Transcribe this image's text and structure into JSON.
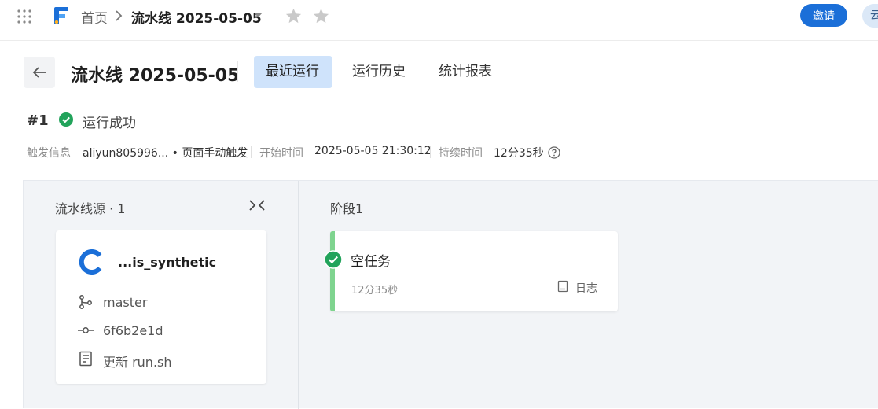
{
  "breadcrumb": {
    "home": "首页",
    "current": "流水线 2025-05-05"
  },
  "topbar": {
    "invite_label": "邀请",
    "avatar_text": "云",
    "brand_color": "#1b6fd8"
  },
  "header": {
    "title": "流水线 2025-05-05",
    "tabs": [
      {
        "label": "最近运行",
        "active": true
      },
      {
        "label": "运行历史",
        "active": false
      },
      {
        "label": "统计报表",
        "active": false
      }
    ]
  },
  "run": {
    "number": "#1",
    "status": "运行成功",
    "status_color": "#22a35b",
    "meta": {
      "trigger_label": "触发信息",
      "trigger_value": "aliyun805996... • 页面手动触发",
      "start_label": "开始时间",
      "start_value": "2025-05-05 21:30:12",
      "duration_label": "持续时间",
      "duration_value": "12分35秒"
    }
  },
  "source": {
    "title": "流水线源 · 1",
    "repo_name": "...is_synthetic",
    "branch": "master",
    "commit": "6f6b2e1d",
    "message": "更新 run.sh"
  },
  "stage": {
    "title": "阶段1",
    "job": {
      "name": "空任务",
      "duration": "12分35秒",
      "log_label": "日志",
      "status": "success"
    }
  }
}
